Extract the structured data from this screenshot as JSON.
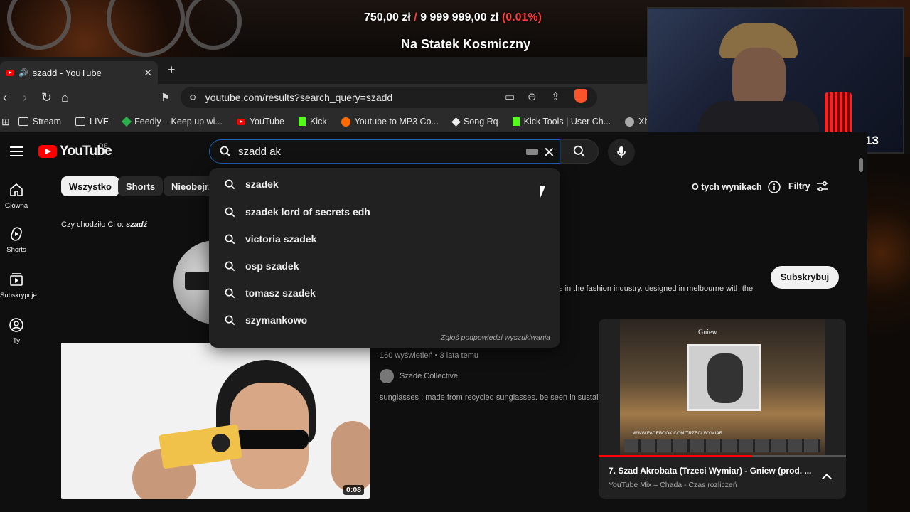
{
  "stream": {
    "goal_current": "750,00 zł",
    "goal_separator": "/",
    "goal_target": "9 999 999,00 zł",
    "goal_percent": "(0.01%)",
    "goal_title": "Na Statek Kosmiczny",
    "webcam_counter": "13"
  },
  "browser": {
    "tab_title": "szadd - YouTube",
    "tab_close": "✕",
    "new_tab": "+",
    "url": "youtube.com/results?search_query=szadd",
    "bookmarks": [
      {
        "label": "Stream",
        "icon": "folder-icon"
      },
      {
        "label": "LIVE",
        "icon": "folder-icon"
      },
      {
        "label": "Feedly – Keep up wi...",
        "icon": "feedly-icon"
      },
      {
        "label": "YouTube",
        "icon": "youtube-icon"
      },
      {
        "label": "Kick",
        "icon": "kick-icon"
      },
      {
        "label": "Youtube to MP3 Co...",
        "icon": "converter-icon"
      },
      {
        "label": "Song Rq",
        "icon": "diamond-icon"
      },
      {
        "label": "Kick Tools | User Ch...",
        "icon": "kick-icon"
      },
      {
        "label": "Xbox Cl",
        "icon": "globe-icon"
      }
    ]
  },
  "youtube": {
    "logo_text": "YouTube",
    "region": "DE",
    "search_value": "szadd ak",
    "sidebar": [
      {
        "label": "Główna",
        "icon": "home-icon"
      },
      {
        "label": "Shorts",
        "icon": "shorts-icon"
      },
      {
        "label": "Subskrypcje",
        "icon": "subscriptions-icon"
      },
      {
        "label": "Ty",
        "icon": "you-icon"
      }
    ],
    "chips": [
      "Wszystko",
      "Shorts",
      "Nieobejrz"
    ],
    "about_results": "O tych wynikach",
    "filters": "Filtry",
    "did_you_mean_prefix": "Czy chodziło Ci o:",
    "did_you_mean_term": "szadź",
    "channel_description": "s in the fashion industry. designed in melbourne with the",
    "subscribe_label": "Subskrybuj",
    "video": {
      "duration": "0:08",
      "meta": "160 wyświetleń • 3 lata temu",
      "channel": "Szade Collective",
      "snippet": "sunglasses ; made from recycled sunglasses. be seen in sustainab"
    },
    "suggestions": [
      "szadek",
      "szadek lord of secrets edh",
      "victoria szadek",
      "osp szadek",
      "tomasz szadek",
      "szymankowo"
    ],
    "suggestion_report": "Zgłoś podpowiedzi wyszukiwania",
    "miniplayer": {
      "art_title": "Gniew",
      "art_footer": "WWW.FACEBOOK.COM/TRZECI.WYMIAR",
      "title": "7. Szad Akrobata (Trzeci Wymiar) - Gniew (prod. ...",
      "subtitle": "YouTube Mix – Chada - Czas rozliczeń",
      "progress": 0.62
    }
  },
  "colors": {
    "accent_red": "#ff0000",
    "search_border": "#1c62b9",
    "goal_red": "#ff3b3b"
  }
}
